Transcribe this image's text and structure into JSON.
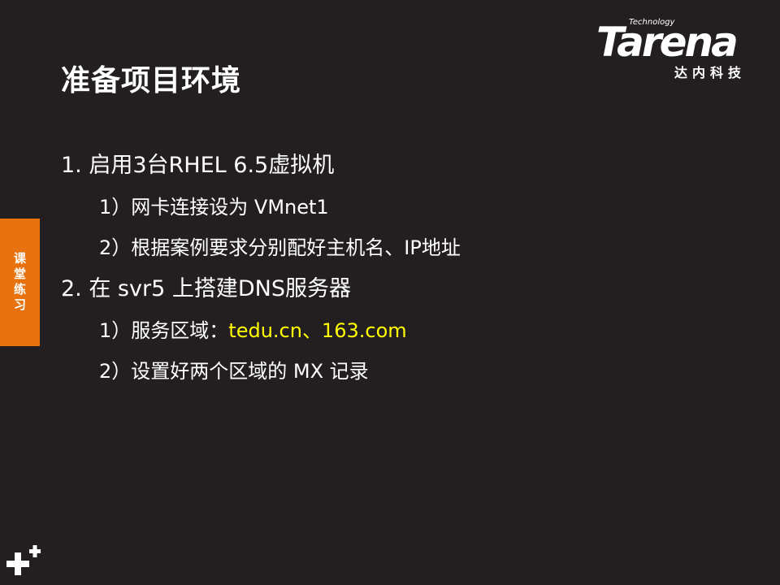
{
  "slide": {
    "title": "准备项目环境"
  },
  "logo": {
    "word": "Tarena",
    "tagline": "Technology",
    "chinese": "达内科技"
  },
  "side_tab": {
    "label": "课堂练习"
  },
  "content": {
    "items": [
      {
        "text": "1. 启用3台RHEL 6.5虚拟机",
        "subs": [
          {
            "prefix": "1）网卡连接设为 VMnet1",
            "highlight": ""
          },
          {
            "prefix": "2）根据案例要求分别配好主机名、IP地址",
            "highlight": ""
          }
        ]
      },
      {
        "text": "2. 在 svr5 上搭建DNS服务器",
        "subs": [
          {
            "prefix": "1）服务区域：",
            "highlight": "tedu.cn、163.com"
          },
          {
            "prefix": "2）设置好两个区域的 MX 记录",
            "highlight": ""
          }
        ]
      }
    ]
  },
  "colors": {
    "background": "#231f20",
    "accent": "#e8720d",
    "highlight": "#ffff00",
    "text": "#ffffff"
  },
  "icons": {
    "bottom_left": "plus-icon"
  }
}
